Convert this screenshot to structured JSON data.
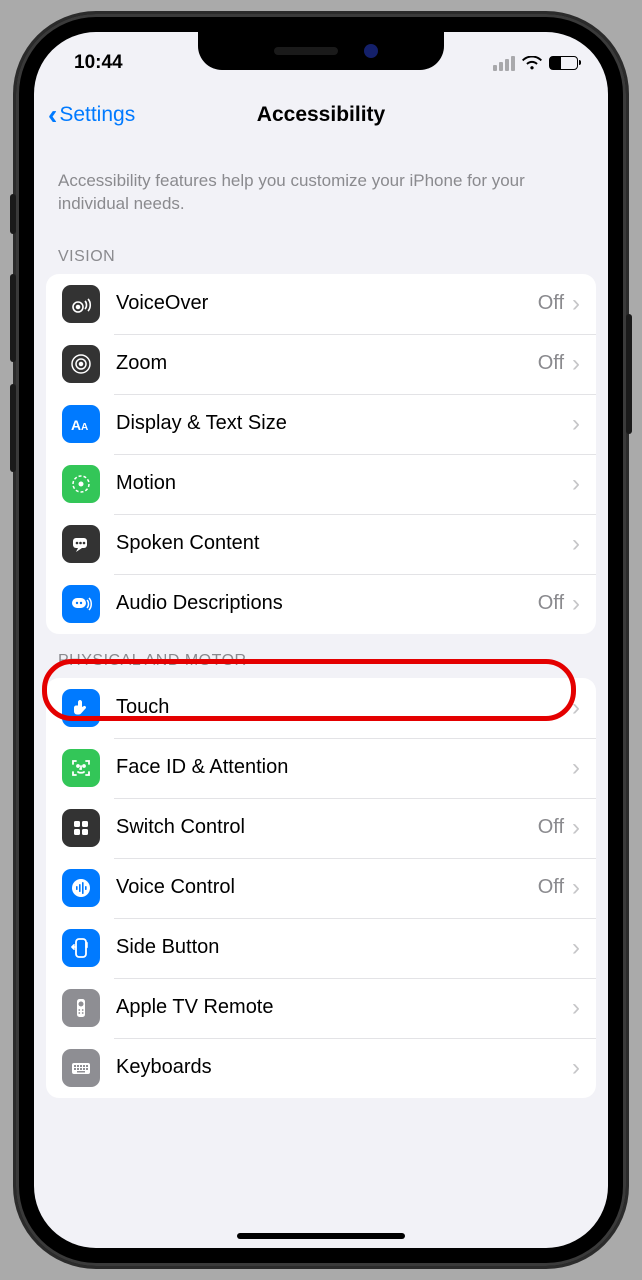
{
  "status": {
    "time": "10:44"
  },
  "nav": {
    "back_label": "Settings",
    "title": "Accessibility"
  },
  "description": "Accessibility features help you customize your iPhone for your individual needs.",
  "sections": {
    "vision": {
      "header": "VISION"
    },
    "motor": {
      "header": "PHYSICAL AND MOTOR"
    }
  },
  "rows": {
    "voiceover": {
      "label": "VoiceOver",
      "status": "Off"
    },
    "zoom": {
      "label": "Zoom",
      "status": "Off"
    },
    "display_text": {
      "label": "Display & Text Size"
    },
    "motion": {
      "label": "Motion"
    },
    "spoken_content": {
      "label": "Spoken Content"
    },
    "audio_descriptions": {
      "label": "Audio Descriptions",
      "status": "Off"
    },
    "touch": {
      "label": "Touch"
    },
    "faceid": {
      "label": "Face ID & Attention"
    },
    "switch_control": {
      "label": "Switch Control",
      "status": "Off"
    },
    "voice_control": {
      "label": "Voice Control",
      "status": "Off"
    },
    "side_button": {
      "label": "Side Button"
    },
    "apple_tv": {
      "label": "Apple TV Remote"
    },
    "keyboards": {
      "label": "Keyboards"
    }
  }
}
